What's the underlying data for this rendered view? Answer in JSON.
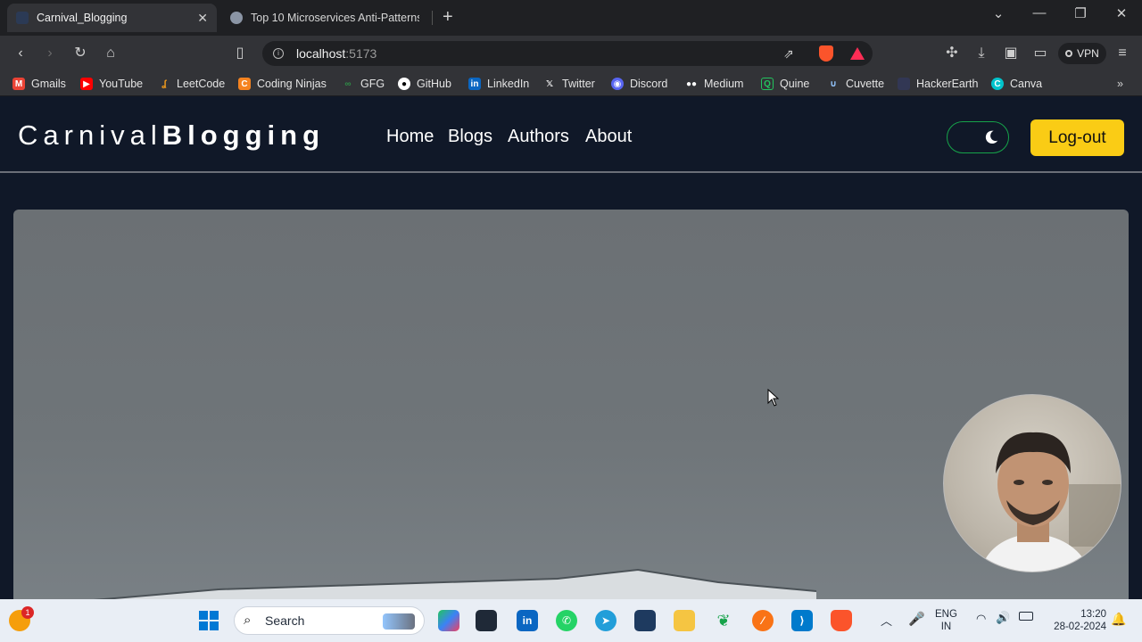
{
  "browser": {
    "tabs": [
      {
        "label": "Carnival_Blogging",
        "active": true
      },
      {
        "label": "Top 10 Microservices Anti-Patterns |",
        "active": false
      }
    ],
    "address": {
      "host": "localhost",
      "port": ":5173"
    },
    "vpn_label": "VPN"
  },
  "bookmarks": [
    {
      "label": "Gmails",
      "icon": "gmail-icon",
      "color": "#ea4335"
    },
    {
      "label": "YouTube",
      "icon": "youtube-icon",
      "color": "#ff0000"
    },
    {
      "label": "LeetCode",
      "icon": "leetcode-icon",
      "color": "#f89f1b"
    },
    {
      "label": "Coding Ninjas",
      "icon": "codingninjas-icon",
      "color": "#f58320"
    },
    {
      "label": "GFG",
      "icon": "gfg-icon",
      "color": "#2f8d46"
    },
    {
      "label": "GitHub",
      "icon": "github-icon",
      "color": "#ffffff"
    },
    {
      "label": "LinkedIn",
      "icon": "linkedin-icon",
      "color": "#0a66c2"
    },
    {
      "label": "Twitter",
      "icon": "x-icon",
      "color": "#000000"
    },
    {
      "label": "Discord",
      "icon": "discord-icon",
      "color": "#5865f2"
    },
    {
      "label": "Medium",
      "icon": "medium-icon",
      "color": "#000000"
    },
    {
      "label": "Quine",
      "icon": "quine-icon",
      "color": "#22c55e"
    },
    {
      "label": "Cuvette",
      "icon": "cuvette-icon",
      "color": "#3b82f6"
    },
    {
      "label": "HackerEarth",
      "icon": "hackerearth-icon",
      "color": "#323754"
    },
    {
      "label": "Canva",
      "icon": "canva-icon",
      "color": "#00c4cc"
    }
  ],
  "site": {
    "brand_light": "Carnival",
    "brand_bold": "Blogging",
    "nav": [
      "Home",
      "Blogs",
      "Authors",
      "About"
    ],
    "logout_label": "Log-out",
    "accent": "#facc15",
    "toggle_border": "#16a34a"
  },
  "taskbar": {
    "notification_count": "1",
    "search_placeholder": "Search",
    "lang_top": "ENG",
    "lang_bottom": "IN",
    "time": "13:20",
    "date": "28-02-2024"
  }
}
